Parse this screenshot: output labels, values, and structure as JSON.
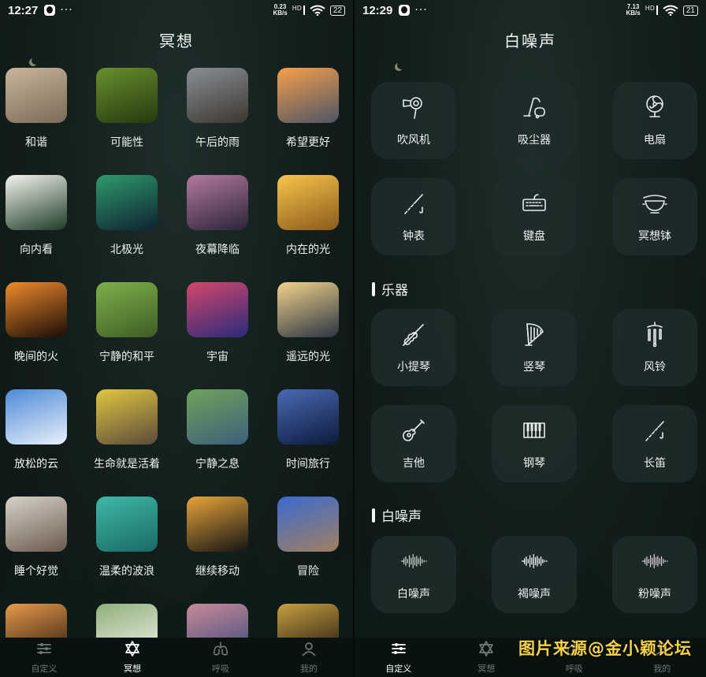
{
  "left_screen": {
    "status": {
      "time": "12:27",
      "speed_top": "0.23",
      "speed_bottom": "KB/s",
      "network": "HD",
      "battery": "22"
    },
    "title": "冥想",
    "items": [
      {
        "label": "和谐",
        "colors": [
          "#c9b59a",
          "#7a6a58"
        ]
      },
      {
        "label": "可能性",
        "colors": [
          "#6a8f2c",
          "#233a10"
        ]
      },
      {
        "label": "午后的雨",
        "colors": [
          "#8a8f95",
          "#3b3630"
        ]
      },
      {
        "label": "希望更好",
        "colors": [
          "#f6a04a",
          "#4c5466"
        ]
      },
      {
        "label": "向内看",
        "colors": [
          "#f5f5f0",
          "#1d3a24"
        ]
      },
      {
        "label": "北极光",
        "colors": [
          "#2f9a6c",
          "#0d2232"
        ]
      },
      {
        "label": "夜幕降临",
        "colors": [
          "#b37a9c",
          "#2b2438"
        ]
      },
      {
        "label": "内在的光",
        "colors": [
          "#f7c54a",
          "#8b5a1c"
        ]
      },
      {
        "label": "晚间的火",
        "colors": [
          "#f08b2c",
          "#1a0c06"
        ]
      },
      {
        "label": "宁静的和平",
        "colors": [
          "#7fb04a",
          "#3f5d25"
        ]
      },
      {
        "label": "宇宙",
        "colors": [
          "#d2476a",
          "#2a2a7a"
        ]
      },
      {
        "label": "遥远的光",
        "colors": [
          "#f3d38a",
          "#2a3442"
        ]
      },
      {
        "label": "放松的云",
        "colors": [
          "#4d8ad8",
          "#e8f0fa"
        ]
      },
      {
        "label": "生命就是活着",
        "colors": [
          "#e2c640",
          "#5a4a3a"
        ]
      },
      {
        "label": "宁静之息",
        "colors": [
          "#6fa35a",
          "#3e5e7a"
        ]
      },
      {
        "label": "时间旅行",
        "colors": [
          "#4a6ab4",
          "#0c1a3c"
        ]
      },
      {
        "label": "睡个好觉",
        "colors": [
          "#d8d2c8",
          "#6b5a4e"
        ]
      },
      {
        "label": "温柔的波浪",
        "colors": [
          "#3fb8a8",
          "#1a6a62"
        ]
      },
      {
        "label": "继续移动",
        "colors": [
          "#e8a43a",
          "#141414"
        ]
      },
      {
        "label": "冒险",
        "colors": [
          "#3a6ad0",
          "#a08060"
        ]
      },
      {
        "label": "",
        "colors": [
          "#e89a4a",
          "#2a1a10"
        ]
      },
      {
        "label": "",
        "colors": [
          "#8fb07a",
          "#f0f0ea"
        ]
      },
      {
        "label": "",
        "colors": [
          "#c98a9a",
          "#3a4a7a"
        ]
      },
      {
        "label": "",
        "colors": [
          "#c9a040",
          "#1a1410"
        ]
      }
    ],
    "nav": [
      {
        "label": "自定义",
        "icon": "sliders-icon",
        "active": false
      },
      {
        "label": "冥想",
        "icon": "star-of-david-icon",
        "active": true
      },
      {
        "label": "呼吸",
        "icon": "lungs-icon",
        "active": false
      },
      {
        "label": "我的",
        "icon": "user-icon",
        "active": false
      }
    ]
  },
  "right_screen": {
    "status": {
      "time": "12:29",
      "speed_top": "7.13",
      "speed_bottom": "KB/s",
      "network": "HD",
      "battery": "21"
    },
    "title": "白噪声",
    "group1": [
      {
        "label": "吹风机",
        "icon": "hair-dryer-icon"
      },
      {
        "label": "吸尘器",
        "icon": "vacuum-icon"
      },
      {
        "label": "电扇",
        "icon": "fan-icon"
      },
      {
        "label": "钟表",
        "icon": "flute-clock-icon"
      },
      {
        "label": "键盘",
        "icon": "keyboard-icon"
      },
      {
        "label": "冥想钵",
        "icon": "singing-bowl-icon"
      }
    ],
    "section_instruments": "乐器",
    "instruments": [
      {
        "label": "小提琴",
        "icon": "violin-icon"
      },
      {
        "label": "竖琴",
        "icon": "harp-icon"
      },
      {
        "label": "风铃",
        "icon": "wind-chime-icon"
      },
      {
        "label": "吉他",
        "icon": "guitar-icon"
      },
      {
        "label": "钢琴",
        "icon": "piano-icon"
      },
      {
        "label": "长笛",
        "icon": "flute-icon"
      }
    ],
    "section_noise": "白噪声",
    "noise": [
      {
        "label": "白噪声",
        "icon": "waveform-icon",
        "color": "#c9d2cf"
      },
      {
        "label": "褐噪声",
        "icon": "waveform-icon",
        "color": "#ffffff"
      },
      {
        "label": "粉噪声",
        "icon": "waveform-icon",
        "color": "#d9d2d8"
      }
    ],
    "nav": [
      {
        "label": "自定义",
        "icon": "sliders-icon",
        "active": true
      },
      {
        "label": "冥想",
        "icon": "star-of-david-icon",
        "active": false
      },
      {
        "label": "呼吸",
        "icon": "lungs-icon",
        "active": false
      },
      {
        "label": "我的",
        "icon": "user-icon",
        "active": false
      }
    ],
    "watermark": "图片来源@金小颖论坛"
  }
}
